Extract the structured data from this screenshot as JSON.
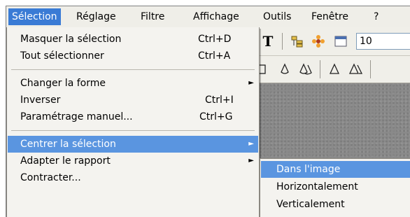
{
  "menubar": {
    "items": [
      "Sélection",
      "Réglage",
      "Filtre",
      "Affichage",
      "Outils",
      "Fenêtre",
      "?"
    ]
  },
  "selection_menu": {
    "items": [
      {
        "label": "Masquer la sélection",
        "shortcut": "Ctrl+D"
      },
      {
        "label": "Tout sélectionner",
        "shortcut": "Ctrl+A"
      },
      {
        "label": "Changer la forme",
        "submenu": true
      },
      {
        "label": "Inverser",
        "shortcut": "Ctrl+I"
      },
      {
        "label": "Paramétrage manuel...",
        "shortcut": "Ctrl+G"
      },
      {
        "label": "Centrer la sélection",
        "submenu": true,
        "highlighted": true
      },
      {
        "label": "Adapter le rapport",
        "submenu": true
      },
      {
        "label": "Contracter..."
      }
    ]
  },
  "center_submenu": {
    "items": [
      {
        "label": "Dans l'image",
        "highlighted": true
      },
      {
        "label": "Horizontalement"
      },
      {
        "label": "Verticalement"
      }
    ]
  },
  "toolbar": {
    "text_tool": "T",
    "zoom_partial": "10"
  },
  "colors": {
    "highlight": "#5a95e0",
    "menubar_active": "#3a7bd5",
    "menu_bg": "#f4f3ef"
  }
}
